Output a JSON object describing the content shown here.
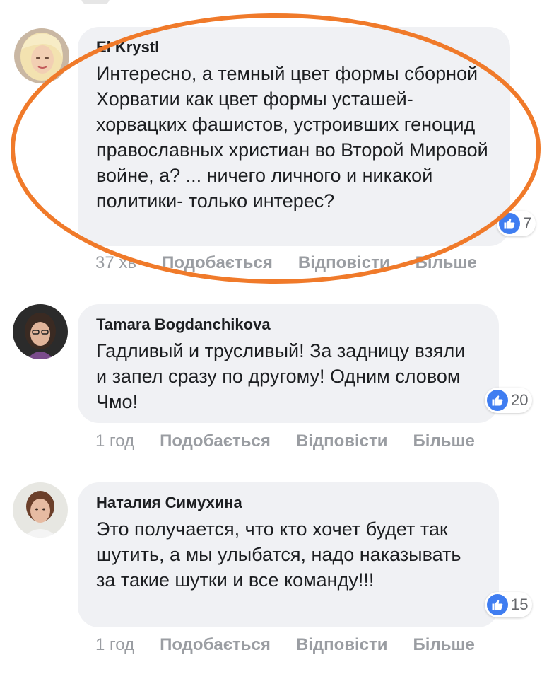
{
  "comments": [
    {
      "author": "El Krystl",
      "text": "Интересно, а темный цвет формы сборной Хорватии как цвет формы усташей- хорвацких фашистов, устроивших геноцид православных христиан во Второй Мировой войне, а? ... ничего личного и никакой политики- только интерес?",
      "likes": "7",
      "time": "37 хв",
      "like_label": "Подобається",
      "reply_label": "Відповісти",
      "more_label": "Більше"
    },
    {
      "author": "Tamara Bogdanchikova",
      "text": "Гадливый и трусливый! За задницу взяли и запел сразу по другому! Одним словом Чмо!",
      "likes": "20",
      "time": "1 год",
      "like_label": "Подобається",
      "reply_label": "Відповісти",
      "more_label": "Більше"
    },
    {
      "author": "Наталия Симухина",
      "text": "Это получается, что кто хочет будет так шутить, а мы улыбатся, надо наказывать за такие шутки и все команду!!!",
      "likes": "15",
      "time": "1 год",
      "like_label": "Подобається",
      "reply_label": "Відповісти",
      "more_label": "Більше"
    }
  ],
  "colors": {
    "bubble": "#f0f1f4",
    "like_blue": "#3f7df1",
    "highlight_oval": "#f07a2a",
    "meta_gray": "#9a9da2"
  },
  "icons": {
    "like": "thumbs-up-icon"
  }
}
